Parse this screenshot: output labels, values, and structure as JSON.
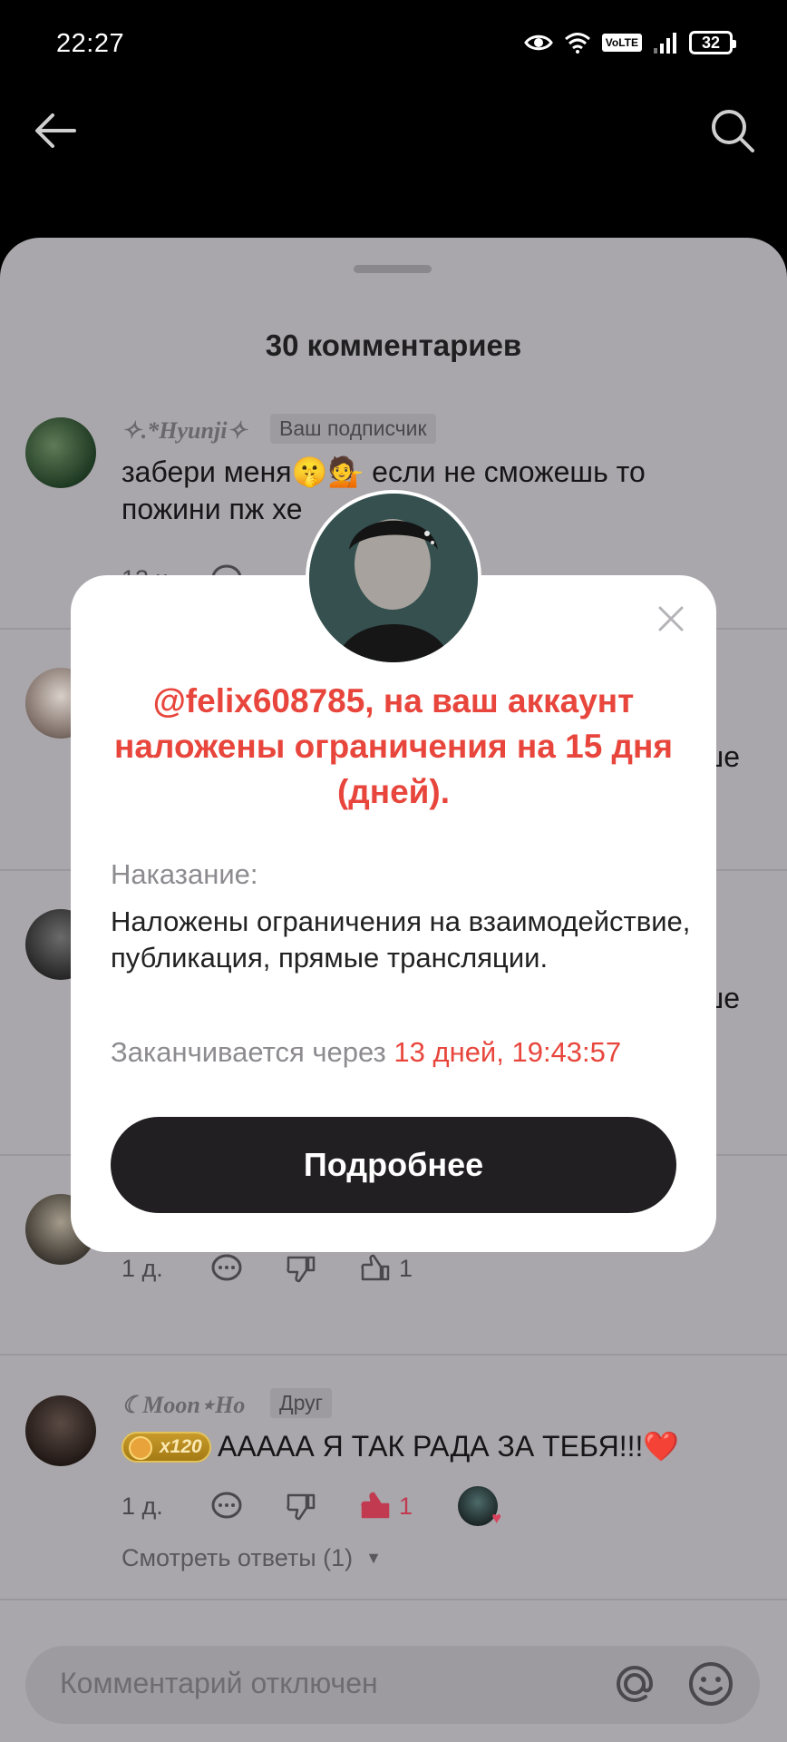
{
  "status_bar": {
    "time": "22:27",
    "volte": "VoLTE",
    "battery": "32"
  },
  "sheet": {
    "title": "30 комментариев"
  },
  "comments": [
    {
      "username": "✧.*Hyunji✧",
      "tag": "Ваш подписчик",
      "text": "забери меня🤫💁 если не сможешь то пожини пж хе",
      "time": "13 ч."
    },
    {
      "edge_text": "ше"
    },
    {
      "edge_text": "ше"
    },
    {
      "time": "1 д.",
      "likes": "1",
      "edge_text": "д"
    },
    {
      "username": "☾Moon⋆Ho",
      "tag": "Друг",
      "badge": "x120",
      "text": "ААААА Я ТАК РАДА ЗА ТЕБЯ!!!❤️",
      "time": "1 д.",
      "likes": "1",
      "view_replies": "Смотреть ответы (1)"
    }
  ],
  "input": {
    "placeholder": "Комментарий отключен"
  },
  "modal": {
    "title": "@felix608785, на ваш аккаунт наложены ограничения на 15 дня (дней).",
    "punishment_label": "Наказание:",
    "punishment_text": "Наложены ограничения на взаимодействие, публикация, прямые трансляции.",
    "expires_label": "Заканчивается через",
    "expires_countdown": "13 дней, 19:43:57",
    "button_label": "Подробнее"
  },
  "colors": {
    "accent_red": "#e8463c",
    "button_dark": "#211f21",
    "overlay_sheet": "#a9a7ab"
  }
}
